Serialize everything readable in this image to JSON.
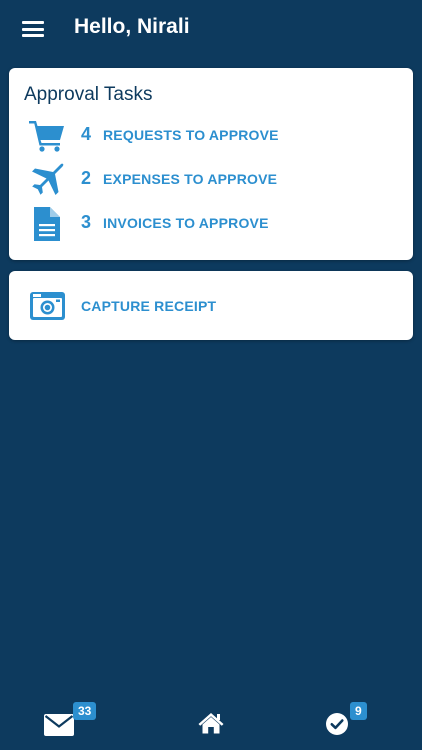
{
  "header": {
    "greeting": "Hello, Nirali"
  },
  "approval_tasks": {
    "title": "Approval Tasks",
    "items": [
      {
        "count": "4",
        "label": "REQUESTS TO APPROVE",
        "icon": "cart-icon"
      },
      {
        "count": "2",
        "label": "EXPENSES TO APPROVE",
        "icon": "airplane-icon"
      },
      {
        "count": "3",
        "label": "INVOICES TO APPROVE",
        "icon": "document-icon"
      }
    ]
  },
  "capture": {
    "label": "CAPTURE RECEIPT",
    "icon": "camera-icon"
  },
  "bottom_nav": {
    "inbox_badge": "33",
    "tasks_badge": "9",
    "icons": [
      "mail-icon",
      "home-icon",
      "check-circle-icon"
    ]
  },
  "colors": {
    "background": "#0d3a5e",
    "accent": "#2c8fcf",
    "card": "#ffffff"
  }
}
